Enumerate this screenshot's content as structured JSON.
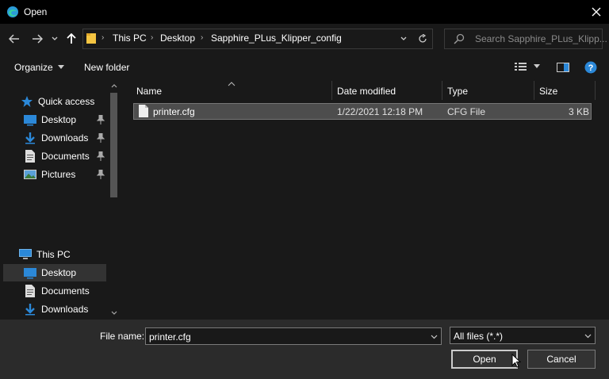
{
  "window": {
    "title": "Open"
  },
  "address": {
    "crumbs": [
      "This PC",
      "Desktop",
      "Sapphire_PLus_Klipper_config"
    ]
  },
  "search": {
    "placeholder": "Search Sapphire_PLus_Klipp..."
  },
  "toolbar": {
    "organize": "Organize",
    "new_folder": "New folder"
  },
  "sidebar": {
    "quick_access": "Quick access",
    "quick_items": [
      "Desktop",
      "Downloads",
      "Documents",
      "Pictures"
    ],
    "this_pc": "This PC",
    "pc_items": [
      "Desktop",
      "Documents",
      "Downloads"
    ]
  },
  "columns": [
    "Name",
    "Date modified",
    "Type",
    "Size"
  ],
  "files": [
    {
      "name": "printer.cfg",
      "date": "1/22/2021 12:18 PM",
      "type": "CFG File",
      "size": "3 KB"
    }
  ],
  "bottom": {
    "file_name_label": "File name:",
    "file_name_value": "printer.cfg",
    "file_type": "All files (*.*)",
    "open": "Open",
    "cancel": "Cancel"
  },
  "colors": {
    "accent": "#2b88d8",
    "folder": "#f5c542",
    "selection": "#4d4d4d"
  }
}
